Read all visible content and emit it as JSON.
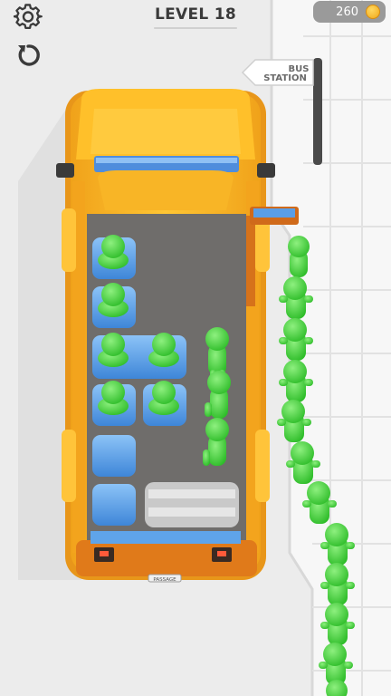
{
  "hud": {
    "level_label": "LEVEL 18",
    "coin_count": "260",
    "settings_icon": "gear-icon",
    "restart_icon": "restart-icon",
    "coin_icon": "coin-icon"
  },
  "sign": {
    "text_line1": "BUS",
    "text_line2": "STATION"
  },
  "bus": {
    "plate_text": "PASSAGE",
    "color": "#f5b21c",
    "seat_color": "#5fa4ea",
    "floor_color": "#6f6d6b"
  },
  "passengers": {
    "color": "#52e04a",
    "seated_count": 6,
    "standing_in_bus": 3,
    "queue_count": 12
  }
}
